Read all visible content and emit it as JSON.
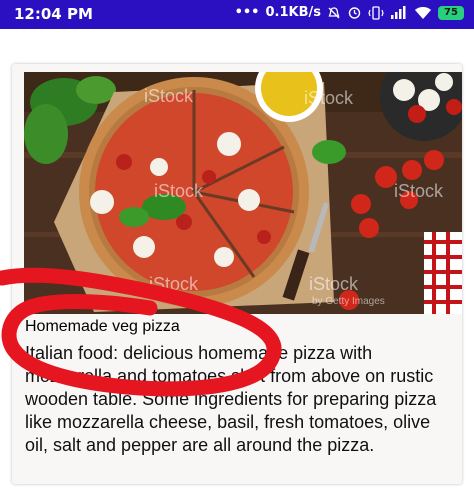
{
  "status_bar": {
    "time": "12:04 PM",
    "network_speed": "0.1KB/s",
    "battery_percent": "75",
    "background_color": "#2a10c0"
  },
  "card": {
    "watermark_text": "iStock",
    "watermark_subtext": "by Getty Images",
    "title": "Homemade veg pizza",
    "description": "Italian food: delicious homemade pizza with mozzarella and tomatoes shot from above on rustic wooden table. Some ingredients for preparing pizza like mozzarella cheese, basil, fresh tomatoes, olive oil, salt and pepper are all around the pizza."
  },
  "annotation": {
    "stroke_color": "#e5161f"
  }
}
